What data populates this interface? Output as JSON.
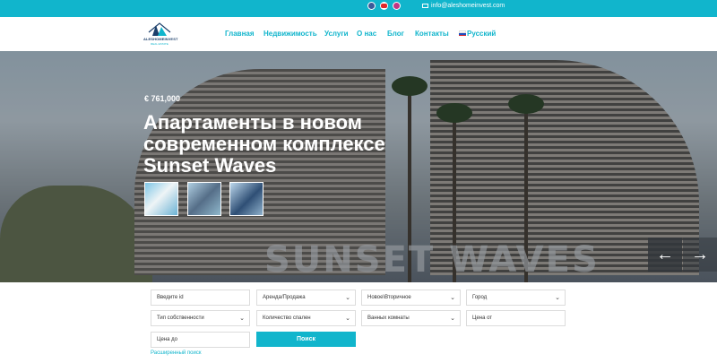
{
  "topbar": {
    "social": [
      "facebook-icon",
      "youtube-icon",
      "instagram-icon"
    ],
    "email": "info@aleshomeinvest.com"
  },
  "header": {
    "logo_text": "ALESHOMEINVEST",
    "logo_sub": "REAL ESTATE",
    "nav": [
      "Главная",
      "Недвижимость",
      "Услуги",
      "О нас",
      "Блог",
      "Контакты",
      "Русский"
    ]
  },
  "hero": {
    "price": "€ 761,000",
    "title": "Апартаменты в новом современном комплексе Sunset Waves",
    "sign_text": "SUNSET WAVES",
    "prev_icon": "←",
    "next_icon": "→"
  },
  "search": {
    "id_placeholder": "Введите id",
    "deal_type": "Аренда/Продажа",
    "condition": "Новое\\Вторичное",
    "city": "Город",
    "property_type": "Тип собственности",
    "bedrooms": "Количество спален",
    "bathrooms": "Ванных комнаты",
    "price_from": "Цена от",
    "price_to": "Цена до",
    "button": "Поиск",
    "advanced": "Расширенный поиск"
  },
  "colors": {
    "accent": "#11b5cc",
    "brand_dark": "#1c3f6b"
  }
}
